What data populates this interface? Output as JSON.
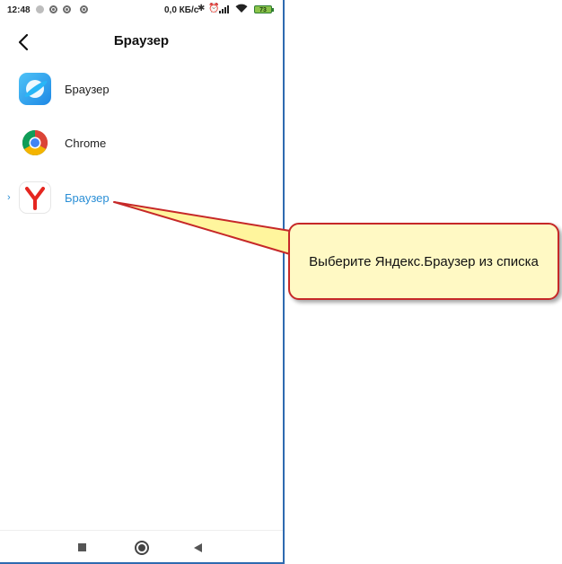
{
  "status_bar": {
    "time": "12:48",
    "net_speed": "0,0 КБ/с",
    "battery": "73"
  },
  "header": {
    "title": "Браузер"
  },
  "apps": [
    {
      "label": "Браузер",
      "icon": "mi-browser-icon",
      "selected": false
    },
    {
      "label": "Chrome",
      "icon": "chrome-icon",
      "selected": false
    },
    {
      "label": "Браузер",
      "icon": "yandex-browser-icon",
      "selected": true
    }
  ],
  "callout": {
    "text": "Выберите Яндекс.Браузер из списка"
  },
  "colors": {
    "selected_text": "#2b8fd6",
    "callout_border": "#c62828",
    "callout_fill": "#fff9c4",
    "frame": "#2e6ab0"
  }
}
